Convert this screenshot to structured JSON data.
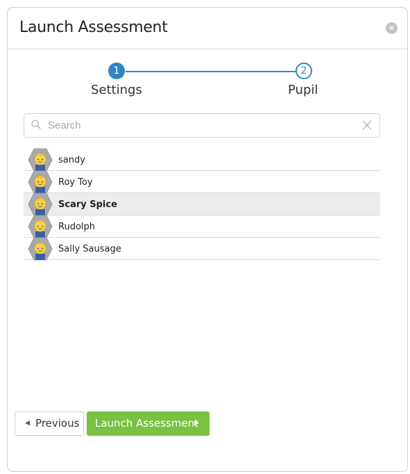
{
  "dialog": {
    "title": "Launch Assessment",
    "close_icon": "close-icon"
  },
  "stepper": {
    "steps": [
      {
        "number": "1",
        "label": "Settings",
        "state": "completed"
      },
      {
        "number": "2",
        "label": "Pupil",
        "state": "current"
      }
    ],
    "accent": "#2d86c7"
  },
  "search": {
    "placeholder": "Search",
    "value": "",
    "icon": "search-icon",
    "clear_icon": "clear-icon"
  },
  "pupils": [
    {
      "name": "sandy",
      "selected": false
    },
    {
      "name": "Roy Toy",
      "selected": false
    },
    {
      "name": "Scary Spice",
      "selected": true
    },
    {
      "name": "Rudolph",
      "selected": false
    },
    {
      "name": "Sally Sausage",
      "selected": false
    }
  ],
  "footer": {
    "previous_label": "Previous",
    "launch_label": "Launch Assessment",
    "launch_color": "#7ac143"
  }
}
